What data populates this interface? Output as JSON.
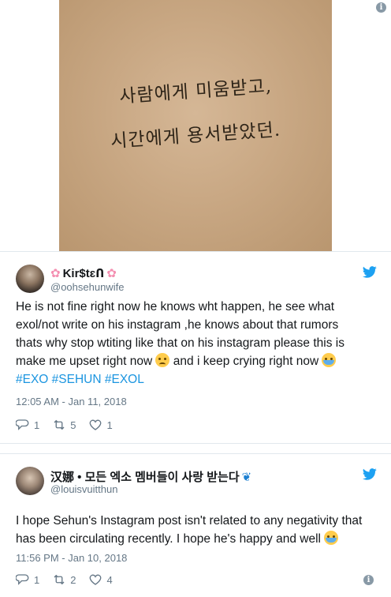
{
  "photo": {
    "line1": "사람에게 미움받고,",
    "line2": "시간에게 용서받았던."
  },
  "info_glyph": "i",
  "tweets": [
    {
      "display_name": "Kir$tɛՈ",
      "handle": "@oohsehunwife",
      "text_part1": "He is not fine right now he knows wht happen, he see what exol/not write on his instagram ,he knows about that rumors thats why stop wtiting like that on his instagram please this is make me upset right now ",
      "text_part2": " and i keep crying right now ",
      "hashtags": [
        "#EXO",
        "#SEHUN",
        "#EXOL"
      ],
      "timestamp": "12:05 AM - Jan 11, 2018",
      "replies": "1",
      "retweets": "5",
      "likes": "1"
    },
    {
      "display_name": "汉娜 • 모든 엑소 멤버들이 사랑 받는다",
      "handle": "@louisvuitthun",
      "text": "I hope Sehun's Instagram post isn't related to any negativity that has been circulating recently. I hope he's happy and well ",
      "timestamp": "11:56 PM - Jan 10, 2018",
      "replies": "1",
      "retweets": "2",
      "likes": "4"
    }
  ],
  "colors": {
    "twitter_blue": "#1da1f2",
    "hashtag": "#1b95e0",
    "secondary_text": "#657786"
  }
}
